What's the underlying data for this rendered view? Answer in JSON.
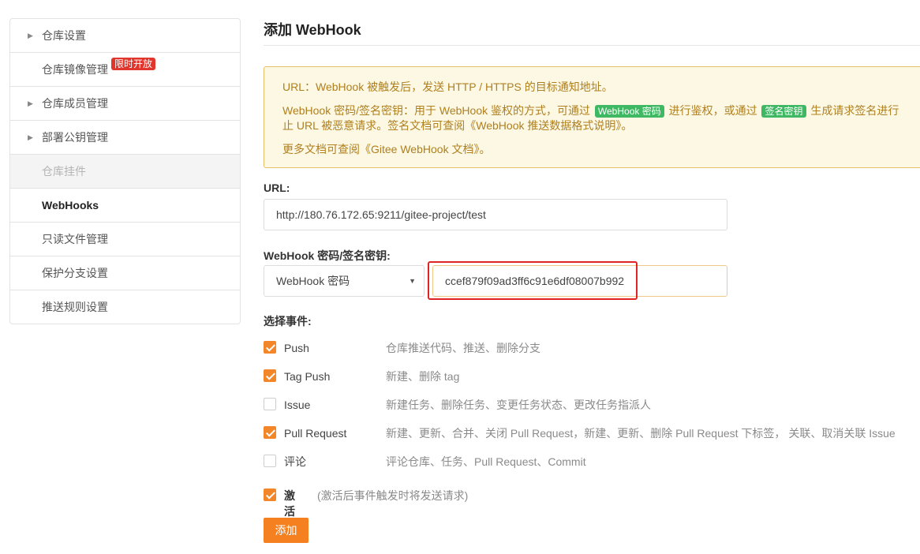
{
  "sidebar": {
    "items": [
      {
        "label": "仓库设置",
        "caret": "▶"
      },
      {
        "label": "仓库镜像管理",
        "badge": "限时开放"
      },
      {
        "label": "仓库成员管理",
        "caret": "▶"
      },
      {
        "label": "部署公钥管理",
        "caret": "▶"
      },
      {
        "label": "仓库挂件"
      },
      {
        "label": "WebHooks"
      },
      {
        "label": "只读文件管理"
      },
      {
        "label": "保护分支设置"
      },
      {
        "label": "推送规则设置"
      }
    ]
  },
  "page": {
    "title": "添加 WebHook"
  },
  "notice": {
    "line1": "URL：WebHook 被触发后，发送 HTTP / HTTPS 的目标通知地址。",
    "line2_pre": "WebHook 密码/签名密钥：用于 WebHook 鉴权的方式，可通过",
    "tag1": "WebHook 密码",
    "line2_mid": "进行鉴权，或通过",
    "tag2": "签名密钥",
    "line2_post": "生成请求签名进行",
    "line3": "止 URL 被恶意请求。签名文档可查阅《WebHook 推送数据格式说明》。",
    "line4": "更多文档可查阅《Gitee WebHook 文档》。"
  },
  "url": {
    "label": "URL:",
    "value": "http://180.76.172.65:9211/gitee-project/test"
  },
  "secret": {
    "label": "WebHook 密码/签名密钥:",
    "type_selected": "WebHook 密码",
    "value": "ccef879f09ad3ff6c91e6df08007b992"
  },
  "events": {
    "label": "选择事件:",
    "items": [
      {
        "name": "Push",
        "desc": "仓库推送代码、推送、删除分支",
        "checked": true
      },
      {
        "name": "Tag Push",
        "desc": "新建、删除 tag",
        "checked": true
      },
      {
        "name": "Issue",
        "desc": "新建任务、删除任务、变更任务状态、更改任务指派人",
        "checked": false
      },
      {
        "name": "Pull Request",
        "desc": "新建、更新、合并、关闭 Pull Request，新建、更新、删除 Pull Request 下标签， 关联、取消关联 Issue",
        "checked": true
      },
      {
        "name": "评论",
        "desc": "评论仓库、任务、Pull Request、Commit",
        "checked": false
      }
    ]
  },
  "activate": {
    "label": "激活",
    "desc": "(激活后事件触发时将发送请求)",
    "checked": true
  },
  "submit": {
    "label": "添加"
  },
  "colors": {
    "accent": "#f5801f",
    "notice_bg": "#fcf8e3",
    "notice_text": "#b07f1e",
    "tag_green": "#3fb863",
    "badge_red": "#e2352b"
  }
}
